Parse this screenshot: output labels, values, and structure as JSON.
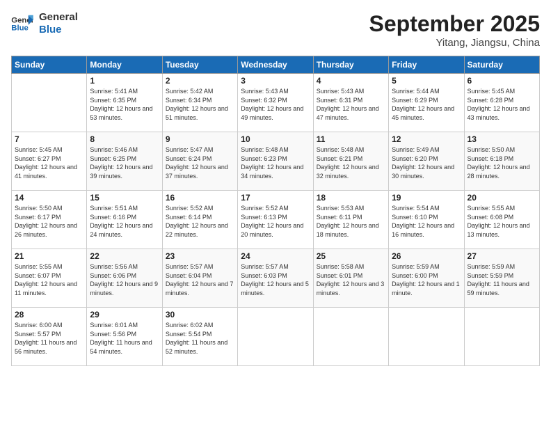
{
  "header": {
    "logo_line1": "General",
    "logo_line2": "Blue",
    "month": "September 2025",
    "location": "Yitang, Jiangsu, China"
  },
  "weekdays": [
    "Sunday",
    "Monday",
    "Tuesday",
    "Wednesday",
    "Thursday",
    "Friday",
    "Saturday"
  ],
  "weeks": [
    [
      {
        "day": "",
        "sunrise": "",
        "sunset": "",
        "daylight": ""
      },
      {
        "day": "1",
        "sunrise": "Sunrise: 5:41 AM",
        "sunset": "Sunset: 6:35 PM",
        "daylight": "Daylight: 12 hours and 53 minutes."
      },
      {
        "day": "2",
        "sunrise": "Sunrise: 5:42 AM",
        "sunset": "Sunset: 6:34 PM",
        "daylight": "Daylight: 12 hours and 51 minutes."
      },
      {
        "day": "3",
        "sunrise": "Sunrise: 5:43 AM",
        "sunset": "Sunset: 6:32 PM",
        "daylight": "Daylight: 12 hours and 49 minutes."
      },
      {
        "day": "4",
        "sunrise": "Sunrise: 5:43 AM",
        "sunset": "Sunset: 6:31 PM",
        "daylight": "Daylight: 12 hours and 47 minutes."
      },
      {
        "day": "5",
        "sunrise": "Sunrise: 5:44 AM",
        "sunset": "Sunset: 6:29 PM",
        "daylight": "Daylight: 12 hours and 45 minutes."
      },
      {
        "day": "6",
        "sunrise": "Sunrise: 5:45 AM",
        "sunset": "Sunset: 6:28 PM",
        "daylight": "Daylight: 12 hours and 43 minutes."
      }
    ],
    [
      {
        "day": "7",
        "sunrise": "Sunrise: 5:45 AM",
        "sunset": "Sunset: 6:27 PM",
        "daylight": "Daylight: 12 hours and 41 minutes."
      },
      {
        "day": "8",
        "sunrise": "Sunrise: 5:46 AM",
        "sunset": "Sunset: 6:25 PM",
        "daylight": "Daylight: 12 hours and 39 minutes."
      },
      {
        "day": "9",
        "sunrise": "Sunrise: 5:47 AM",
        "sunset": "Sunset: 6:24 PM",
        "daylight": "Daylight: 12 hours and 37 minutes."
      },
      {
        "day": "10",
        "sunrise": "Sunrise: 5:48 AM",
        "sunset": "Sunset: 6:23 PM",
        "daylight": "Daylight: 12 hours and 34 minutes."
      },
      {
        "day": "11",
        "sunrise": "Sunrise: 5:48 AM",
        "sunset": "Sunset: 6:21 PM",
        "daylight": "Daylight: 12 hours and 32 minutes."
      },
      {
        "day": "12",
        "sunrise": "Sunrise: 5:49 AM",
        "sunset": "Sunset: 6:20 PM",
        "daylight": "Daylight: 12 hours and 30 minutes."
      },
      {
        "day": "13",
        "sunrise": "Sunrise: 5:50 AM",
        "sunset": "Sunset: 6:18 PM",
        "daylight": "Daylight: 12 hours and 28 minutes."
      }
    ],
    [
      {
        "day": "14",
        "sunrise": "Sunrise: 5:50 AM",
        "sunset": "Sunset: 6:17 PM",
        "daylight": "Daylight: 12 hours and 26 minutes."
      },
      {
        "day": "15",
        "sunrise": "Sunrise: 5:51 AM",
        "sunset": "Sunset: 6:16 PM",
        "daylight": "Daylight: 12 hours and 24 minutes."
      },
      {
        "day": "16",
        "sunrise": "Sunrise: 5:52 AM",
        "sunset": "Sunset: 6:14 PM",
        "daylight": "Daylight: 12 hours and 22 minutes."
      },
      {
        "day": "17",
        "sunrise": "Sunrise: 5:52 AM",
        "sunset": "Sunset: 6:13 PM",
        "daylight": "Daylight: 12 hours and 20 minutes."
      },
      {
        "day": "18",
        "sunrise": "Sunrise: 5:53 AM",
        "sunset": "Sunset: 6:11 PM",
        "daylight": "Daylight: 12 hours and 18 minutes."
      },
      {
        "day": "19",
        "sunrise": "Sunrise: 5:54 AM",
        "sunset": "Sunset: 6:10 PM",
        "daylight": "Daylight: 12 hours and 16 minutes."
      },
      {
        "day": "20",
        "sunrise": "Sunrise: 5:55 AM",
        "sunset": "Sunset: 6:08 PM",
        "daylight": "Daylight: 12 hours and 13 minutes."
      }
    ],
    [
      {
        "day": "21",
        "sunrise": "Sunrise: 5:55 AM",
        "sunset": "Sunset: 6:07 PM",
        "daylight": "Daylight: 12 hours and 11 minutes."
      },
      {
        "day": "22",
        "sunrise": "Sunrise: 5:56 AM",
        "sunset": "Sunset: 6:06 PM",
        "daylight": "Daylight: 12 hours and 9 minutes."
      },
      {
        "day": "23",
        "sunrise": "Sunrise: 5:57 AM",
        "sunset": "Sunset: 6:04 PM",
        "daylight": "Daylight: 12 hours and 7 minutes."
      },
      {
        "day": "24",
        "sunrise": "Sunrise: 5:57 AM",
        "sunset": "Sunset: 6:03 PM",
        "daylight": "Daylight: 12 hours and 5 minutes."
      },
      {
        "day": "25",
        "sunrise": "Sunrise: 5:58 AM",
        "sunset": "Sunset: 6:01 PM",
        "daylight": "Daylight: 12 hours and 3 minutes."
      },
      {
        "day": "26",
        "sunrise": "Sunrise: 5:59 AM",
        "sunset": "Sunset: 6:00 PM",
        "daylight": "Daylight: 12 hours and 1 minute."
      },
      {
        "day": "27",
        "sunrise": "Sunrise: 5:59 AM",
        "sunset": "Sunset: 5:59 PM",
        "daylight": "Daylight: 11 hours and 59 minutes."
      }
    ],
    [
      {
        "day": "28",
        "sunrise": "Sunrise: 6:00 AM",
        "sunset": "Sunset: 5:57 PM",
        "daylight": "Daylight: 11 hours and 56 minutes."
      },
      {
        "day": "29",
        "sunrise": "Sunrise: 6:01 AM",
        "sunset": "Sunset: 5:56 PM",
        "daylight": "Daylight: 11 hours and 54 minutes."
      },
      {
        "day": "30",
        "sunrise": "Sunrise: 6:02 AM",
        "sunset": "Sunset: 5:54 PM",
        "daylight": "Daylight: 11 hours and 52 minutes."
      },
      {
        "day": "",
        "sunrise": "",
        "sunset": "",
        "daylight": ""
      },
      {
        "day": "",
        "sunrise": "",
        "sunset": "",
        "daylight": ""
      },
      {
        "day": "",
        "sunrise": "",
        "sunset": "",
        "daylight": ""
      },
      {
        "day": "",
        "sunrise": "",
        "sunset": "",
        "daylight": ""
      }
    ]
  ]
}
